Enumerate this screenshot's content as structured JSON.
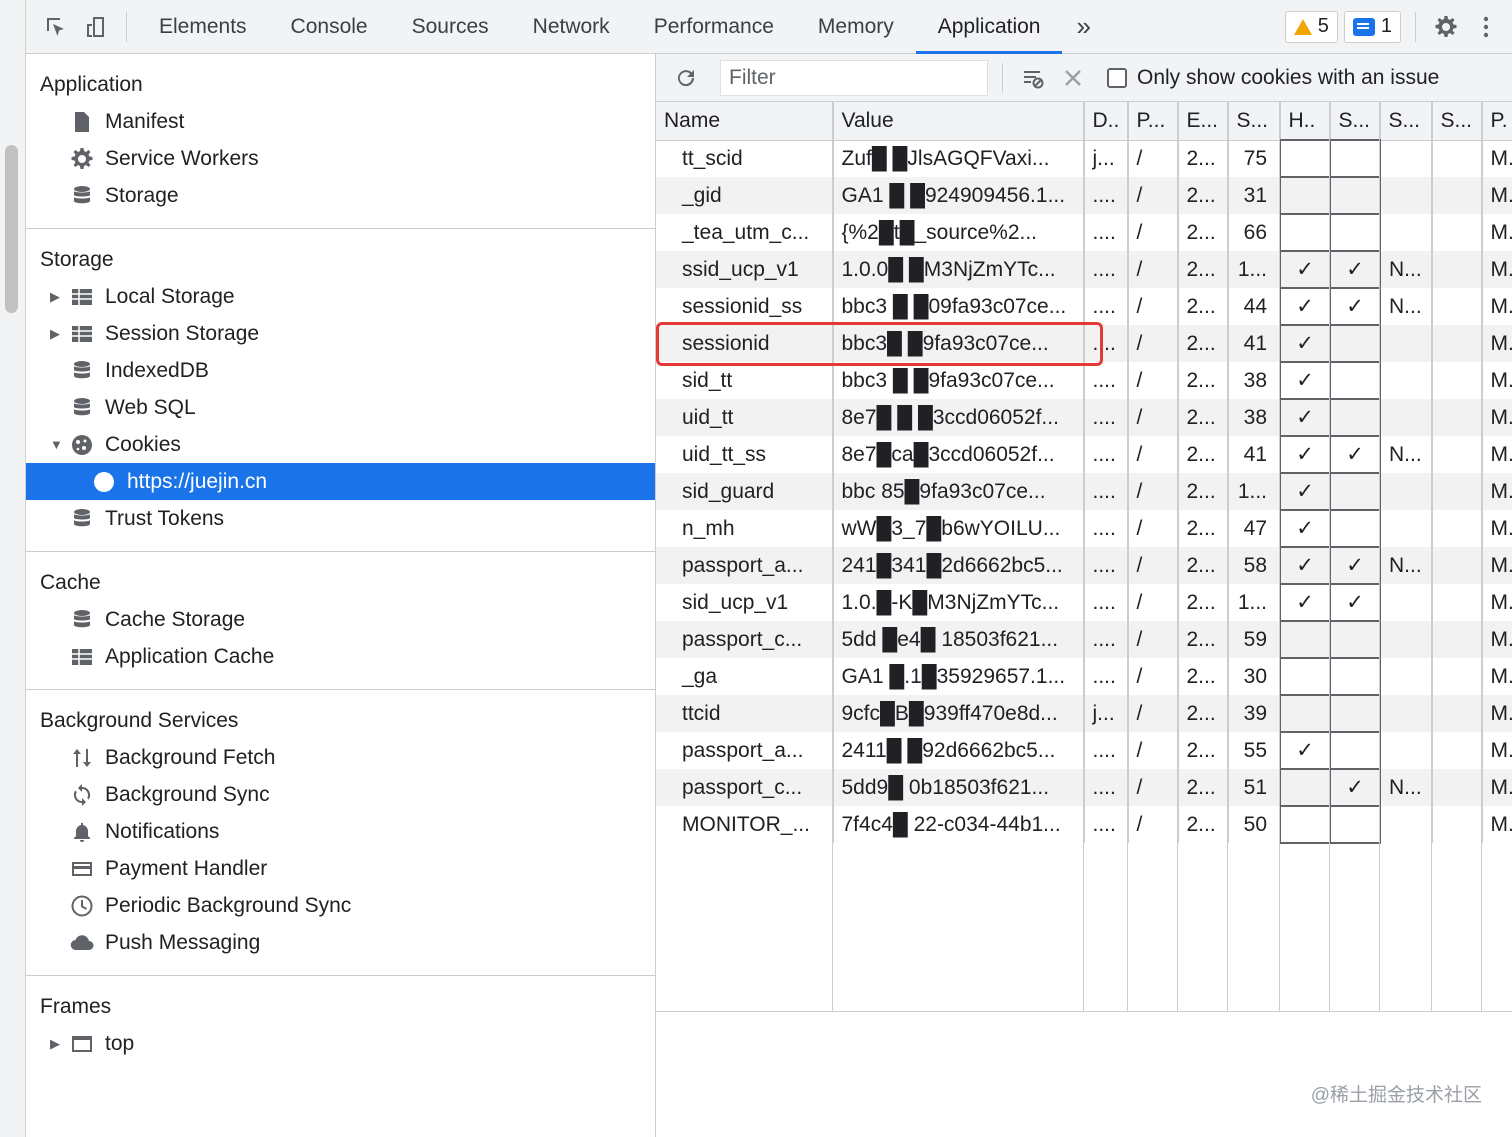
{
  "toolbar": {
    "tabs": [
      "Elements",
      "Console",
      "Sources",
      "Network",
      "Performance",
      "Memory",
      "Application"
    ],
    "more": "»",
    "warnings": "5",
    "messages": "1"
  },
  "sidebar": {
    "application": {
      "title": "Application",
      "items": [
        "Manifest",
        "Service Workers",
        "Storage"
      ]
    },
    "storage": {
      "title": "Storage",
      "items": [
        "Local Storage",
        "Session Storage",
        "IndexedDB",
        "Web SQL",
        "Cookies",
        "https://juejin.cn",
        "Trust Tokens"
      ]
    },
    "cache": {
      "title": "Cache",
      "items": [
        "Cache Storage",
        "Application Cache"
      ]
    },
    "background": {
      "title": "Background Services",
      "items": [
        "Background Fetch",
        "Background Sync",
        "Notifications",
        "Payment Handler",
        "Periodic Background Sync",
        "Push Messaging"
      ]
    },
    "frames": {
      "title": "Frames",
      "items": [
        "top"
      ]
    }
  },
  "filterbar": {
    "placeholder": "Filter",
    "only_issue_label": "Only show cookies with an issue"
  },
  "table": {
    "columns": [
      "Name",
      "Value",
      "D..",
      "P...",
      "E...",
      "S...",
      "H..",
      "S...",
      "S...",
      "S...",
      "P."
    ],
    "rows": [
      [
        "tt_scid",
        "Zuf█ █JlsAGQFVaxi...",
        "j...",
        "/",
        "2...",
        "75",
        "",
        "",
        "",
        "",
        "M."
      ],
      [
        "_gid",
        "GA1 █ █924909456.1...",
        "....",
        "/",
        "2...",
        "31",
        "",
        "",
        "",
        "",
        "M."
      ],
      [
        "_tea_utm_c...",
        "{%2█t█_source%2...",
        "....",
        "/",
        "2...",
        "66",
        "",
        "",
        "",
        "",
        "M."
      ],
      [
        "ssid_ucp_v1",
        "1.0.0█ █M3NjZmYTc...",
        "....",
        "/",
        "2...",
        "1...",
        "✓",
        "✓",
        "N...",
        "",
        "M."
      ],
      [
        "sessionid_ss",
        "bbc3 █ █09fa93c07ce...",
        "....",
        "/",
        "2...",
        "44",
        "✓",
        "✓",
        "N...",
        "",
        "M."
      ],
      [
        "sessionid",
        "bbc3█ █9fa93c07ce...",
        "....",
        "/",
        "2...",
        "41",
        "✓",
        "",
        "",
        "",
        "M."
      ],
      [
        "sid_tt",
        "bbc3 █ █9fa93c07ce...",
        "....",
        "/",
        "2...",
        "38",
        "✓",
        "",
        "",
        "",
        "M."
      ],
      [
        "uid_tt",
        "8e7█ █ █3ccd06052f...",
        "....",
        "/",
        "2...",
        "38",
        "✓",
        "",
        "",
        "",
        "M."
      ],
      [
        "uid_tt_ss",
        "8e7█ca█3ccd06052f...",
        "....",
        "/",
        "2...",
        "41",
        "✓",
        "✓",
        "N...",
        "",
        "M."
      ],
      [
        "sid_guard",
        "bbc 85█9fa93c07ce...",
        "....",
        "/",
        "2...",
        "1...",
        "✓",
        "",
        "",
        "",
        "M."
      ],
      [
        "n_mh",
        "wW█3_7█b6wYOILU...",
        "....",
        "/",
        "2...",
        "47",
        "✓",
        "",
        "",
        "",
        "M."
      ],
      [
        "passport_a...",
        "241█341█2d6662bc5...",
        "....",
        "/",
        "2...",
        "58",
        "✓",
        "✓",
        "N...",
        "",
        "M."
      ],
      [
        "sid_ucp_v1",
        "1.0.█-K█M3NjZmYTc...",
        "....",
        "/",
        "2...",
        "1...",
        "✓",
        "✓",
        "",
        "",
        "M."
      ],
      [
        "passport_c...",
        "5dd █e4█ 18503f621...",
        "....",
        "/",
        "2...",
        "59",
        "",
        "",
        "",
        "",
        "M."
      ],
      [
        "_ga",
        "GA1 █.1█35929657.1...",
        "....",
        "/",
        "2...",
        "30",
        "",
        "",
        "",
        "",
        "M."
      ],
      [
        "ttcid",
        "9cfc█B█939ff470e8d...",
        "j...",
        "/",
        "2...",
        "39",
        "",
        "",
        "",
        "",
        "M."
      ],
      [
        "passport_a...",
        "2411█ █92d6662bc5...",
        "....",
        "/",
        "2...",
        "55",
        "✓",
        "",
        "",
        "",
        "M."
      ],
      [
        "passport_c...",
        "5dd9█ 0b18503f621...",
        "....",
        "/",
        "2...",
        "51",
        "",
        "✓",
        "N...",
        "",
        "M."
      ],
      [
        "MONITOR_...",
        "7f4c4█ 22-c034-44b1...",
        "....",
        "/",
        "2...",
        "50",
        "",
        "",
        "",
        "",
        "M."
      ]
    ]
  },
  "watermark": "@稀土掘金技术社区",
  "colors": {
    "accent": "#1a73e8",
    "highlight": "#e53935",
    "warning": "#f2a600"
  }
}
